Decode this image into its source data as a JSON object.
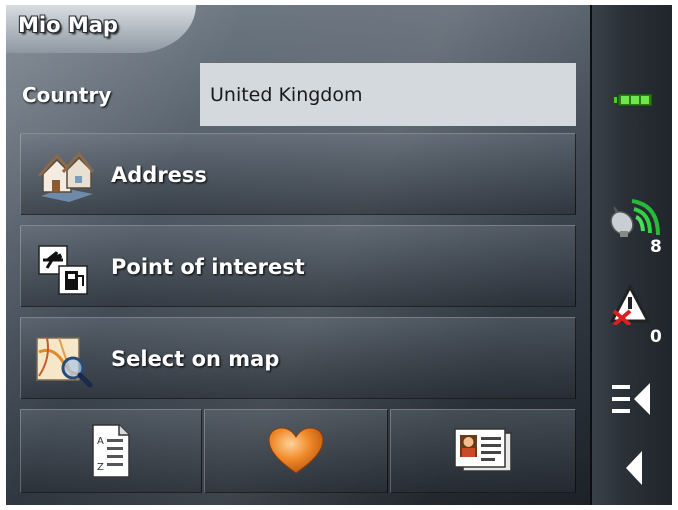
{
  "app": {
    "title": "Mio Map"
  },
  "country": {
    "label": "Country",
    "value": "United Kingdom"
  },
  "menu": [
    {
      "label": "Address",
      "icon": "house-icon"
    },
    {
      "label": "Point of interest",
      "icon": "poi-icon"
    },
    {
      "label": "Select on map",
      "icon": "map-search-icon"
    }
  ],
  "toolbar": [
    {
      "icon": "list-icon"
    },
    {
      "icon": "heart-icon"
    },
    {
      "icon": "contact-card-icon"
    }
  ],
  "status": {
    "satellites": "8",
    "alerts": "0",
    "battery_color": "#4ccb2a"
  }
}
